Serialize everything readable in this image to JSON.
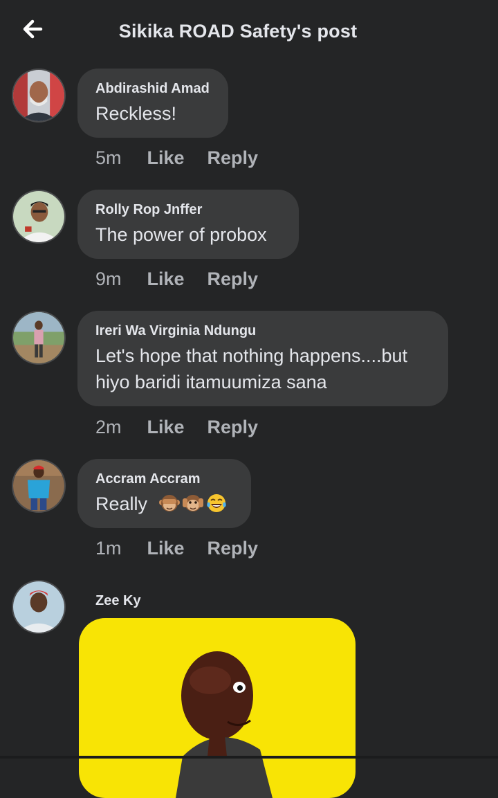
{
  "header": {
    "title": "Sikika ROAD Safety's post",
    "back_icon": "arrow-left-icon"
  },
  "comments": [
    {
      "author": "Abdirashid Amad",
      "text": "Reckless!",
      "time": "5m",
      "like": "Like",
      "reply": "Reply"
    },
    {
      "author": "Rolly Rop Jnffer",
      "text": "The power of probox",
      "time": "9m",
      "like": "Like",
      "reply": "Reply"
    },
    {
      "author": "Ireri Wa Virginia Ndungu",
      "text_line1": "Let's hope that nothing happens....but",
      "text_line2": "hiyo baridi itamuumiza sana",
      "time": "2m",
      "like": "Like",
      "reply": "Reply"
    },
    {
      "author": "Accram Accram",
      "text": "Really",
      "emojis": [
        "see-no-evil-monkey-icon",
        "hear-no-evil-monkey-icon",
        "tears-of-joy-icon"
      ],
      "time": "1m",
      "like": "Like",
      "reply": "Reply"
    },
    {
      "author": "Zee Ky",
      "attachment": "sticker"
    }
  ],
  "colors": {
    "background": "#242526",
    "bubble": "#3a3b3c",
    "text": "#e4e6eb",
    "secondary_text": "#b0b3b8",
    "sticker_bg": "#f8e405"
  }
}
